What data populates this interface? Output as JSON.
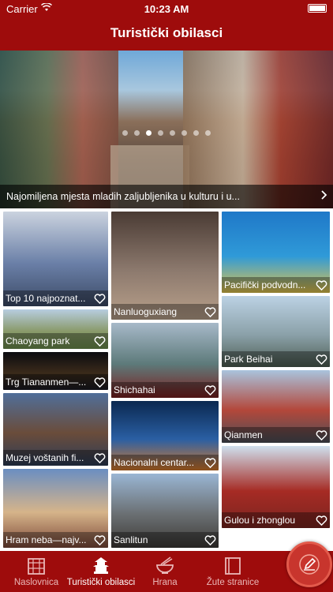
{
  "status_bar": {
    "carrier": "Carrier",
    "time": "10:23 AM"
  },
  "nav": {
    "title": "Turistički obilasci"
  },
  "featured": {
    "caption": "Najomiljena mjesta mladih zaljubljenika u kulturu i u...",
    "page_count": 8,
    "current_page": 2
  },
  "tiles": [
    {
      "label": "Top 10 najpoznat...",
      "colors": [
        "#cbd3df",
        "#6a7fa7",
        "#3c4a66"
      ]
    },
    {
      "label": "Chaoyang park",
      "colors": [
        "#b7cde0",
        "#8a9a6b",
        "#6d8f4d"
      ]
    },
    {
      "label": "Trg Tiananmen—...",
      "colors": [
        "#0b0b10",
        "#3a2a1a",
        "#1a1a22"
      ]
    },
    {
      "label": "Muzej voštanih fi...",
      "colors": [
        "#506f9a",
        "#6a4c3a",
        "#2d3c56"
      ]
    },
    {
      "label": "Hram neba—najv...",
      "colors": [
        "#6a8ec2",
        "#d6b48a",
        "#7d4a3a"
      ]
    },
    {
      "label": "Nanluoguxiang",
      "colors": [
        "#4a3b34",
        "#8d7a6e",
        "#b9a18b"
      ]
    },
    {
      "label": "Shichahai",
      "colors": [
        "#a7b9c9",
        "#5d7a7a",
        "#7a1f1f"
      ]
    },
    {
      "label": "Nacionalni centar...",
      "colors": [
        "#0b2850",
        "#2a5fa3",
        "#d87a2b"
      ]
    },
    {
      "label": "Sanlitun",
      "colors": [
        "#9ab6d4",
        "#6a6f72",
        "#3d3a37"
      ]
    },
    {
      "label": "Pacifički podvodn...",
      "colors": [
        "#1f78c8",
        "#2f9ad8",
        "#e3c44a"
      ]
    },
    {
      "label": "Park Beihai",
      "colors": [
        "#bcd2e4",
        "#8aa0a8",
        "#4d5d52"
      ]
    },
    {
      "label": "Qianmen",
      "colors": [
        "#a9c3dd",
        "#b3473a",
        "#4a4f57"
      ]
    },
    {
      "label": "Gulou i zhonglou",
      "colors": [
        "#cfe0ee",
        "#a62b24",
        "#7a2420"
      ]
    }
  ],
  "tabs": [
    {
      "label": "Naslovnica",
      "icon": "home-icon",
      "active": false
    },
    {
      "label": "Turistički obilasci",
      "icon": "pagoda-icon",
      "active": true
    },
    {
      "label": "Hrana",
      "icon": "bowl-icon",
      "active": false
    },
    {
      "label": "Žute stranice",
      "icon": "book-icon",
      "active": false
    }
  ],
  "colors": {
    "primary": "#9e0c0c",
    "fab": "#c8352d"
  }
}
